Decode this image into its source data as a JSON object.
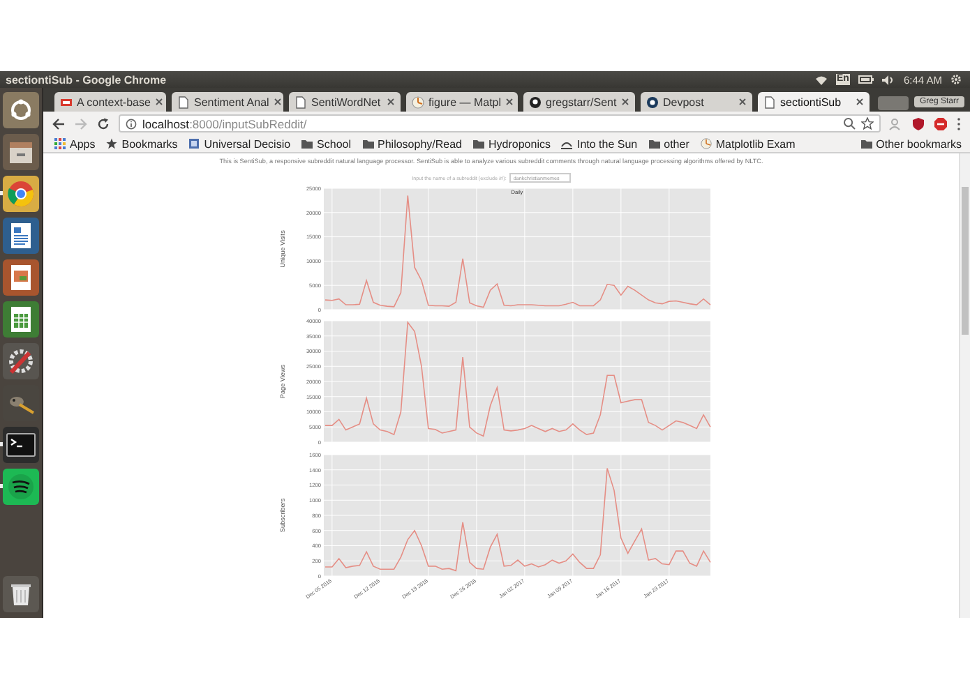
{
  "panel": {
    "title": "sectiontiSub - Google Chrome",
    "keyboard_layout": "En",
    "time": "6:44 AM"
  },
  "launcher": [
    {
      "kind": "ubuntu",
      "running": false
    },
    {
      "kind": "files",
      "running": false
    },
    {
      "kind": "browser",
      "running": true
    },
    {
      "kind": "writer",
      "running": false
    },
    {
      "kind": "impress",
      "running": false
    },
    {
      "kind": "calc",
      "running": false
    },
    {
      "kind": "settings",
      "running": false
    },
    {
      "kind": "gimp",
      "running": false
    },
    {
      "kind": "terminal",
      "running": true
    },
    {
      "kind": "music",
      "running": true
    },
    {
      "kind": "trash",
      "running": false
    }
  ],
  "tabs": [
    {
      "label": "A context-base",
      "kind": "pdf",
      "selected": false
    },
    {
      "label": "Sentiment Anal",
      "kind": "page",
      "selected": false
    },
    {
      "label": "SentiWordNet",
      "kind": "page",
      "selected": false
    },
    {
      "label": "figure — Matpl",
      "kind": "matplotlib",
      "selected": false
    },
    {
      "label": "gregstarr/Sent",
      "kind": "github",
      "selected": false
    },
    {
      "label": "Devpost",
      "kind": "devpost",
      "selected": false
    },
    {
      "label": "sectiontiSub",
      "kind": "page",
      "selected": true
    }
  ],
  "profile": "Greg Starr",
  "toolbar": {
    "forward_disabled": true,
    "url": "**localhost**:8000/inputSubReddit/"
  },
  "bookmarks": [
    {
      "label": "Apps",
      "kind": "apps"
    },
    {
      "label": "Bookmarks",
      "kind": "star"
    },
    {
      "label": "Universal Decisio",
      "kind": "page"
    },
    {
      "label": "School",
      "kind": "folder"
    },
    {
      "label": "Philosophy/Read",
      "kind": "folder"
    },
    {
      "label": "Hydroponics",
      "kind": "folder"
    },
    {
      "label": "Into the Sun",
      "kind": "sun"
    },
    {
      "label": "other",
      "kind": "folder"
    },
    {
      "label": "Matplotlib Exam",
      "kind": "matplotlib"
    }
  ],
  "other_bookmarks": "Other bookmarks",
  "page": {
    "intro": "This is SentiSub, a responsive subreddit natural language processor. SentiSub is able to analyze various subreddit comments through natural language processing algorithms offered by NLTC.",
    "prompt": "Input the name of a subreddit (exclude /r/):",
    "field_value": "dankchristianmemes"
  },
  "charts": [
    {
      "chart_data": {
        "type": "line",
        "grid": true,
        "title": "Daily",
        "ylabel": "Unique Visits",
        "ylim": [
          0,
          25000
        ],
        "yticks": [
          0,
          5000,
          10000,
          15000,
          20000,
          25000
        ],
        "categories": [
          null,
          null,
          null,
          null,
          null,
          null,
          null,
          null,
          null,
          null,
          null,
          null,
          null,
          null,
          null,
          null,
          null,
          null,
          null,
          null,
          null,
          null,
          null,
          null,
          null,
          null,
          null,
          null,
          null,
          null,
          null,
          null,
          null,
          null,
          null,
          null,
          null,
          null,
          null,
          null,
          null,
          null,
          null,
          null,
          null,
          null,
          null,
          null,
          null,
          null,
          null,
          null,
          null,
          null,
          null,
          null,
          null
        ],
        "values": [
          2000,
          1900,
          2200,
          1000,
          1000,
          1100,
          6000,
          1500,
          900,
          700,
          600,
          3500,
          23500,
          8700,
          6000,
          900,
          800,
          800,
          700,
          1500,
          10500,
          1400,
          800,
          500,
          4000,
          5300,
          900,
          800,
          1000,
          1000,
          1000,
          900,
          800,
          800,
          800,
          1100,
          1500,
          800,
          800,
          800,
          2000,
          5200,
          5000,
          3000,
          4800,
          4000,
          3000,
          2000,
          1400,
          1200,
          1700,
          1800,
          1500,
          1200,
          1000,
          2200,
          1000
        ]
      }
    },
    {
      "chart_data": {
        "type": "line",
        "grid": true,
        "ylabel": "Page Views",
        "ylim": [
          0,
          40000
        ],
        "yticks": [
          0,
          5000,
          10000,
          15000,
          20000,
          25000,
          30000,
          35000,
          40000
        ],
        "categories": [
          null,
          null,
          null,
          null,
          null,
          null,
          null,
          null,
          null,
          null,
          null,
          null,
          null,
          null,
          null,
          null,
          null,
          null,
          null,
          null,
          null,
          null,
          null,
          null,
          null,
          null,
          null,
          null,
          null,
          null,
          null,
          null,
          null,
          null,
          null,
          null,
          null,
          null,
          null,
          null,
          null,
          null,
          null,
          null,
          null,
          null,
          null,
          null,
          null,
          null,
          null,
          null,
          null,
          null,
          null,
          null,
          null
        ],
        "values": [
          5500,
          5500,
          7500,
          4000,
          5000,
          6000,
          14500,
          6000,
          4000,
          3500,
          2500,
          10000,
          39500,
          36500,
          25000,
          4500,
          4200,
          3000,
          3500,
          4000,
          28000,
          5000,
          3000,
          2000,
          12000,
          18000,
          4000,
          3700,
          4000,
          4500,
          5500,
          4500,
          3500,
          4500,
          3500,
          4000,
          6000,
          4000,
          2500,
          3000,
          9000,
          22000,
          22000,
          13000,
          13500,
          14000,
          14000,
          6500,
          5500,
          4000,
          5500,
          7000,
          6500,
          5500,
          4500,
          9000,
          5000
        ]
      }
    },
    {
      "chart_data": {
        "type": "line",
        "grid": true,
        "ylabel": "Subscribers",
        "ylim": [
          0,
          1600
        ],
        "yticks": [
          0,
          200,
          400,
          600,
          800,
          1000,
          1200,
          1400,
          1600
        ],
        "categories": [
          null,
          "Dec 05 2016",
          null,
          null,
          null,
          null,
          null,
          null,
          "Dec 12 2016",
          null,
          null,
          null,
          null,
          null,
          null,
          "Dec 19 2016",
          null,
          null,
          null,
          null,
          null,
          null,
          "Dec 26 2016",
          null,
          null,
          null,
          null,
          null,
          null,
          "Jan 02 2017",
          null,
          null,
          null,
          null,
          null,
          null,
          "Jan 09 2017",
          null,
          null,
          null,
          null,
          null,
          null,
          "Jan 16 2017",
          null,
          null,
          null,
          null,
          null,
          null,
          "Jan 23 2017",
          null,
          null,
          null,
          null,
          null,
          null
        ],
        "values": [
          120,
          120,
          230,
          110,
          130,
          140,
          320,
          130,
          90,
          90,
          90,
          250,
          480,
          600,
          400,
          130,
          130,
          90,
          100,
          70,
          710,
          180,
          100,
          90,
          380,
          550,
          130,
          140,
          210,
          130,
          160,
          120,
          150,
          210,
          170,
          200,
          290,
          180,
          100,
          100,
          280,
          1420,
          1130,
          500,
          300,
          460,
          620,
          210,
          230,
          160,
          150,
          330,
          330,
          170,
          130,
          330,
          180
        ]
      }
    }
  ]
}
